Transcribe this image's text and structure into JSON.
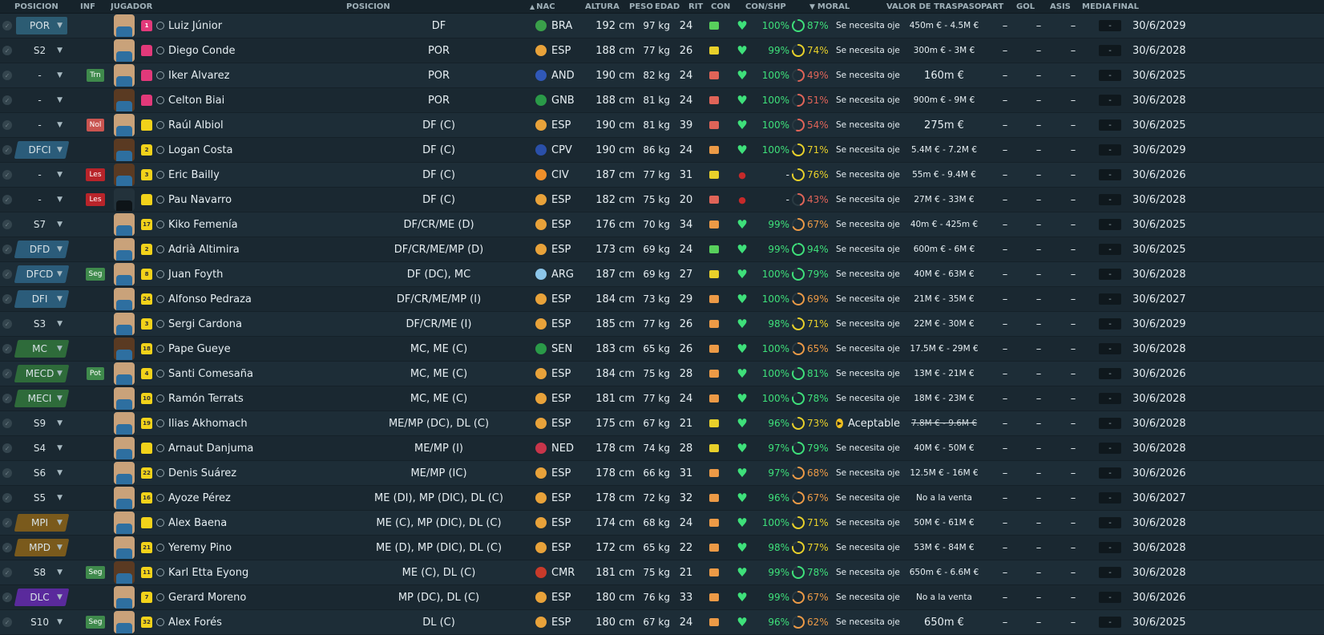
{
  "headers": {
    "pos": "POSICIÓN",
    "inf": "INF",
    "player": "JUGADOR",
    "position": "POSICIÓN",
    "nat": "NAC",
    "height": "ALTURA",
    "weight": "PESO",
    "age": "EDAD",
    "rit": "RIT",
    "con": "CON",
    "conshp": "CON/SHP",
    "moral": "MORAL",
    "value": "VALOR DE TRASPASO",
    "part": "PART",
    "gol": "GOL",
    "asis": "ASIS",
    "media": "MEDIA",
    "final": "FINAL",
    "sort_arrow": "▲",
    "moral_arrow": "▼"
  },
  "rows": [
    {
      "pos": "POR",
      "pos_style": "gk",
      "inf": "",
      "inf_style": "",
      "face": "",
      "shirt": "pink",
      "shirt_no": "1",
      "name": "Luiz Júnior",
      "position": "DF",
      "nat_text": "BRA",
      "flag": "#3aa04a",
      "height": "192 cm",
      "weight": "97 kg",
      "age": "24",
      "rit": "g",
      "con": "heart",
      "con_pct": "100%",
      "shp": "87%",
      "shp_c": "g",
      "shp_frac": 0.87,
      "moral": "Se necesita ojeo",
      "moral_ok": false,
      "value": "450m € - 4.5M €",
      "value_big": false,
      "value_strike": false,
      "part": "–",
      "gol": "–",
      "asis": "–",
      "media": "-",
      "final": "30/6/2029"
    },
    {
      "pos": "S2",
      "pos_style": "plain",
      "inf": "",
      "inf_style": "",
      "face": "",
      "shirt": "pink",
      "shirt_no": "",
      "name": "Diego Conde",
      "position": "POR",
      "nat_text": "ESP",
      "flag": "#e8a23a",
      "height": "188 cm",
      "weight": "77 kg",
      "age": "26",
      "rit": "y",
      "con": "heart",
      "con_pct": "99%",
      "shp": "74%",
      "shp_c": "y",
      "shp_frac": 0.74,
      "moral": "Se necesita ojeo",
      "moral_ok": false,
      "value": "300m € - 3M €",
      "value_big": false,
      "value_strike": false,
      "part": "–",
      "gol": "–",
      "asis": "–",
      "media": "-",
      "final": "30/6/2028"
    },
    {
      "pos": "-",
      "pos_style": "plain",
      "inf": "Trn",
      "inf_style": "trn",
      "face": "",
      "shirt": "pink",
      "shirt_no": "",
      "name": "Iker Álvarez",
      "position": "POR",
      "nat_text": "AND",
      "flag": "#3058b8",
      "height": "190 cm",
      "weight": "82 kg",
      "age": "24",
      "rit": "r",
      "con": "heart",
      "con_pct": "100%",
      "shp": "49%",
      "shp_c": "r",
      "shp_frac": 0.49,
      "moral": "Se necesita ojeo",
      "moral_ok": false,
      "value": "160m €",
      "value_big": true,
      "value_strike": false,
      "part": "–",
      "gol": "–",
      "asis": "–",
      "media": "-",
      "final": "30/6/2025"
    },
    {
      "pos": "-",
      "pos_style": "plain",
      "inf": "",
      "inf_style": "",
      "face": "dark",
      "shirt": "pink",
      "shirt_no": "",
      "name": "Celton Biai",
      "position": "POR",
      "nat_text": "GNB",
      "flag": "#2a9a48",
      "height": "188 cm",
      "weight": "81 kg",
      "age": "24",
      "rit": "r",
      "con": "heart",
      "con_pct": "100%",
      "shp": "51%",
      "shp_c": "r",
      "shp_frac": 0.51,
      "moral": "Se necesita ojeo",
      "moral_ok": false,
      "value": "900m € - 9M €",
      "value_big": false,
      "value_strike": false,
      "part": "–",
      "gol": "–",
      "asis": "–",
      "media": "-",
      "final": "30/6/2028"
    },
    {
      "pos": "-",
      "pos_style": "plain",
      "inf": "Nol",
      "inf_style": "nol",
      "face": "",
      "shirt": "yellow",
      "shirt_no": "",
      "name": "Raúl Albiol",
      "position": "DF (C)",
      "nat_text": "ESP",
      "flag": "#e8a23a",
      "height": "190 cm",
      "weight": "81 kg",
      "age": "39",
      "rit": "r",
      "con": "heart",
      "con_pct": "100%",
      "shp": "54%",
      "shp_c": "r",
      "shp_frac": 0.54,
      "moral": "Se necesita ojeo",
      "moral_ok": false,
      "value": "275m €",
      "value_big": true,
      "value_strike": false,
      "part": "–",
      "gol": "–",
      "asis": "–",
      "media": "-",
      "final": "30/6/2025"
    },
    {
      "pos": "DFCI",
      "pos_style": "def",
      "inf": "",
      "inf_style": "",
      "face": "dark",
      "shirt": "yellow",
      "shirt_no": "2",
      "name": "Logan Costa",
      "position": "DF (C)",
      "nat_text": "CPV",
      "flag": "#2a4fa8",
      "height": "190 cm",
      "weight": "86 kg",
      "age": "24",
      "rit": "o",
      "con": "heart",
      "con_pct": "100%",
      "shp": "71%",
      "shp_c": "y",
      "shp_frac": 0.71,
      "moral": "Se necesita ojeo",
      "moral_ok": false,
      "value": "5.4M € - 7.2M €",
      "value_big": false,
      "value_strike": false,
      "part": "–",
      "gol": "–",
      "asis": "–",
      "media": "-",
      "final": "30/6/2029"
    },
    {
      "pos": "-",
      "pos_style": "plain",
      "inf": "Les",
      "inf_style": "les",
      "face": "dark",
      "shirt": "yellow",
      "shirt_no": "3",
      "name": "Éric Bailly",
      "position": "DF (C)",
      "nat_text": "CIV",
      "flag": "#f0902a",
      "height": "187 cm",
      "weight": "77 kg",
      "age": "31",
      "rit": "y",
      "con": "inj",
      "con_pct": "-",
      "shp": "76%",
      "shp_c": "y",
      "shp_frac": 0.76,
      "moral": "Se necesita ojeo",
      "moral_ok": false,
      "value": "55m € - 9.4M €",
      "value_big": false,
      "value_strike": false,
      "part": "–",
      "gol": "–",
      "asis": "–",
      "media": "-",
      "final": "30/6/2026"
    },
    {
      "pos": "-",
      "pos_style": "plain",
      "inf": "Les",
      "inf_style": "les",
      "face": "blank",
      "shirt": "yellow",
      "shirt_no": "",
      "name": "Pau Navarro",
      "position": "DF (C)",
      "nat_text": "ESP",
      "flag": "#e8a23a",
      "height": "182 cm",
      "weight": "75 kg",
      "age": "20",
      "rit": "r",
      "con": "inj",
      "con_pct": "-",
      "shp": "43%",
      "shp_c": "r",
      "shp_frac": 0.43,
      "moral": "Se necesita ojeo",
      "moral_ok": false,
      "value": "27M € - 33M €",
      "value_big": false,
      "value_strike": false,
      "part": "–",
      "gol": "–",
      "asis": "–",
      "media": "-",
      "final": "30/6/2028"
    },
    {
      "pos": "S7",
      "pos_style": "plain",
      "inf": "",
      "inf_style": "",
      "face": "",
      "shirt": "yellow",
      "shirt_no": "17",
      "name": "Kiko Femenía",
      "position": "DF/CR/ME (D)",
      "nat_text": "ESP",
      "flag": "#e8a23a",
      "height": "176 cm",
      "weight": "70 kg",
      "age": "34",
      "rit": "o",
      "con": "heart",
      "con_pct": "99%",
      "shp": "67%",
      "shp_c": "o",
      "shp_frac": 0.67,
      "moral": "Se necesita ojeo",
      "moral_ok": false,
      "value": "40m € - 425m €",
      "value_big": false,
      "value_strike": false,
      "part": "–",
      "gol": "–",
      "asis": "–",
      "media": "-",
      "final": "30/6/2025"
    },
    {
      "pos": "DFD",
      "pos_style": "def",
      "inf": "",
      "inf_style": "",
      "face": "",
      "shirt": "yellow",
      "shirt_no": "2",
      "name": "Adrià Altimira",
      "position": "DF/CR/ME/MP (D)",
      "nat_text": "ESP",
      "flag": "#e8a23a",
      "height": "173 cm",
      "weight": "69 kg",
      "age": "24",
      "rit": "g",
      "con": "heart",
      "con_pct": "99%",
      "shp": "94%",
      "shp_c": "g",
      "shp_frac": 0.94,
      "moral": "Se necesita ojeo",
      "moral_ok": false,
      "value": "600m € - 6M €",
      "value_big": false,
      "value_strike": false,
      "part": "–",
      "gol": "–",
      "asis": "–",
      "media": "-",
      "final": "30/6/2025"
    },
    {
      "pos": "DFCD",
      "pos_style": "def",
      "inf": "Seg",
      "inf_style": "seg",
      "face": "",
      "shirt": "yellow",
      "shirt_no": "8",
      "name": "Juan Foyth",
      "position": "DF (DC), MC",
      "nat_text": "ARG",
      "flag": "#8cc6ea",
      "height": "187 cm",
      "weight": "69 kg",
      "age": "27",
      "rit": "y",
      "con": "heart",
      "con_pct": "100%",
      "shp": "79%",
      "shp_c": "g",
      "shp_frac": 0.79,
      "moral": "Se necesita ojeo",
      "moral_ok": false,
      "value": "40M € - 63M €",
      "value_big": false,
      "value_strike": false,
      "part": "–",
      "gol": "–",
      "asis": "–",
      "media": "-",
      "final": "30/6/2028"
    },
    {
      "pos": "DFI",
      "pos_style": "def",
      "inf": "",
      "inf_style": "",
      "face": "",
      "shirt": "yellow",
      "shirt_no": "24",
      "name": "Alfonso Pedraza",
      "position": "DF/CR/ME/MP (I)",
      "nat_text": "ESP",
      "flag": "#e8a23a",
      "height": "184 cm",
      "weight": "73 kg",
      "age": "29",
      "rit": "o",
      "con": "heart",
      "con_pct": "100%",
      "shp": "69%",
      "shp_c": "o",
      "shp_frac": 0.69,
      "moral": "Se necesita ojeo",
      "moral_ok": false,
      "value": "21M € - 35M €",
      "value_big": false,
      "value_strike": false,
      "part": "–",
      "gol": "–",
      "asis": "–",
      "media": "-",
      "final": "30/6/2027"
    },
    {
      "pos": "S3",
      "pos_style": "plain",
      "inf": "",
      "inf_style": "",
      "face": "",
      "shirt": "yellow",
      "shirt_no": "3",
      "name": "Sergi Cardona",
      "position": "DF/CR/ME (I)",
      "nat_text": "ESP",
      "flag": "#e8a23a",
      "height": "185 cm",
      "weight": "77 kg",
      "age": "26",
      "rit": "o",
      "con": "heart",
      "con_pct": "98%",
      "shp": "71%",
      "shp_c": "y",
      "shp_frac": 0.71,
      "moral": "Se necesita ojeo",
      "moral_ok": false,
      "value": "22M € - 30M €",
      "value_big": false,
      "value_strike": false,
      "part": "–",
      "gol": "–",
      "asis": "–",
      "media": "-",
      "final": "30/6/2029"
    },
    {
      "pos": "MC",
      "pos_style": "mid",
      "inf": "",
      "inf_style": "",
      "face": "dark",
      "shirt": "yellow",
      "shirt_no": "18",
      "name": "Pape Gueye",
      "position": "MC, ME (C)",
      "nat_text": "SEN",
      "flag": "#2a9a48",
      "height": "183 cm",
      "weight": "65 kg",
      "age": "26",
      "rit": "o",
      "con": "heart",
      "con_pct": "100%",
      "shp": "65%",
      "shp_c": "o",
      "shp_frac": 0.65,
      "moral": "Se necesita ojeo",
      "moral_ok": false,
      "value": "17.5M € - 29M €",
      "value_big": false,
      "value_strike": false,
      "part": "–",
      "gol": "–",
      "asis": "–",
      "media": "-",
      "final": "30/6/2028"
    },
    {
      "pos": "MECD",
      "pos_style": "mid",
      "inf": "Pot",
      "inf_style": "pot",
      "face": "",
      "shirt": "yellow",
      "shirt_no": "4",
      "name": "Santi Comesaña",
      "position": "MC, ME (C)",
      "nat_text": "ESP",
      "flag": "#e8a23a",
      "height": "184 cm",
      "weight": "75 kg",
      "age": "28",
      "rit": "o",
      "con": "heart",
      "con_pct": "100%",
      "shp": "81%",
      "shp_c": "g",
      "shp_frac": 0.81,
      "moral": "Se necesita ojeo",
      "moral_ok": false,
      "value": "13M € - 21M €",
      "value_big": false,
      "value_strike": false,
      "part": "–",
      "gol": "–",
      "asis": "–",
      "media": "-",
      "final": "30/6/2026"
    },
    {
      "pos": "MECI",
      "pos_style": "mid",
      "inf": "",
      "inf_style": "",
      "face": "",
      "shirt": "yellow",
      "shirt_no": "10",
      "name": "Ramón Terrats",
      "position": "MC, ME (C)",
      "nat_text": "ESP",
      "flag": "#e8a23a",
      "height": "181 cm",
      "weight": "77 kg",
      "age": "24",
      "rit": "o",
      "con": "heart",
      "con_pct": "100%",
      "shp": "78%",
      "shp_c": "g",
      "shp_frac": 0.78,
      "moral": "Se necesita ojeo",
      "moral_ok": false,
      "value": "18M € - 23M €",
      "value_big": false,
      "value_strike": false,
      "part": "–",
      "gol": "–",
      "asis": "–",
      "media": "-",
      "final": "30/6/2028"
    },
    {
      "pos": "S9",
      "pos_style": "plain",
      "inf": "",
      "inf_style": "",
      "face": "",
      "shirt": "yellow",
      "shirt_no": "19",
      "name": "Ilias Akhomach",
      "position": "ME/MP (DC), DL (C)",
      "nat_text": "ESP",
      "flag": "#e8a23a",
      "height": "175 cm",
      "weight": "67 kg",
      "age": "21",
      "rit": "y",
      "con": "heart",
      "con_pct": "96%",
      "shp": "73%",
      "shp_c": "y",
      "shp_frac": 0.73,
      "moral": "Aceptable",
      "moral_ok": true,
      "value": "7.8M € - 9.6M €",
      "value_big": false,
      "value_strike": true,
      "part": "–",
      "gol": "–",
      "asis": "–",
      "media": "-",
      "final": "30/6/2028"
    },
    {
      "pos": "S4",
      "pos_style": "plain",
      "inf": "",
      "inf_style": "",
      "face": "",
      "shirt": "yellow",
      "shirt_no": "",
      "name": "Arnaut Danjuma",
      "position": "ME/MP (I)",
      "nat_text": "NED",
      "flag": "#c8354a",
      "height": "178 cm",
      "weight": "74 kg",
      "age": "28",
      "rit": "y",
      "con": "heart",
      "con_pct": "97%",
      "shp": "79%",
      "shp_c": "g",
      "shp_frac": 0.79,
      "moral": "Se necesita ojeo",
      "moral_ok": false,
      "value": "40M € - 50M €",
      "value_big": false,
      "value_strike": false,
      "part": "–",
      "gol": "–",
      "asis": "–",
      "media": "-",
      "final": "30/6/2028"
    },
    {
      "pos": "S6",
      "pos_style": "plain",
      "inf": "",
      "inf_style": "",
      "face": "",
      "shirt": "yellow",
      "shirt_no": "22",
      "name": "Denis Suárez",
      "position": "ME/MP (IC)",
      "nat_text": "ESP",
      "flag": "#e8a23a",
      "height": "178 cm",
      "weight": "66 kg",
      "age": "31",
      "rit": "o",
      "con": "heart",
      "con_pct": "97%",
      "shp": "68%",
      "shp_c": "o",
      "shp_frac": 0.68,
      "moral": "Se necesita ojeo",
      "moral_ok": false,
      "value": "12.5M € - 16M €",
      "value_big": false,
      "value_strike": false,
      "part": "–",
      "gol": "–",
      "asis": "–",
      "media": "-",
      "final": "30/6/2026"
    },
    {
      "pos": "S5",
      "pos_style": "plain",
      "inf": "",
      "inf_style": "",
      "face": "",
      "shirt": "yellow",
      "shirt_no": "16",
      "name": "Ayoze Pérez",
      "position": "ME (DI), MP (DIC), DL (C)",
      "nat_text": "ESP",
      "flag": "#e8a23a",
      "height": "178 cm",
      "weight": "72 kg",
      "age": "32",
      "rit": "o",
      "con": "heart",
      "con_pct": "96%",
      "shp": "67%",
      "shp_c": "o",
      "shp_frac": 0.67,
      "moral": "Se necesita ojeo",
      "moral_ok": false,
      "value": "No a la venta",
      "value_big": false,
      "value_strike": false,
      "part": "–",
      "gol": "–",
      "asis": "–",
      "media": "-",
      "final": "30/6/2027"
    },
    {
      "pos": "MPI",
      "pos_style": "wing",
      "inf": "",
      "inf_style": "",
      "face": "",
      "shirt": "yellow",
      "shirt_no": "",
      "name": "Álex Baena",
      "position": "ME (C), MP (DIC), DL (C)",
      "nat_text": "ESP",
      "flag": "#e8a23a",
      "height": "174 cm",
      "weight": "68 kg",
      "age": "24",
      "rit": "o",
      "con": "heart",
      "con_pct": "100%",
      "shp": "71%",
      "shp_c": "y",
      "shp_frac": 0.71,
      "moral": "Se necesita ojeo",
      "moral_ok": false,
      "value": "50M € - 61M €",
      "value_big": false,
      "value_strike": false,
      "part": "–",
      "gol": "–",
      "asis": "–",
      "media": "-",
      "final": "30/6/2028"
    },
    {
      "pos": "MPD",
      "pos_style": "wing",
      "inf": "",
      "inf_style": "",
      "face": "",
      "shirt": "yellow",
      "shirt_no": "21",
      "name": "Yeremy Pino",
      "position": "ME (D), MP (DIC), DL (C)",
      "nat_text": "ESP",
      "flag": "#e8a23a",
      "height": "172 cm",
      "weight": "65 kg",
      "age": "22",
      "rit": "o",
      "con": "heart",
      "con_pct": "98%",
      "shp": "77%",
      "shp_c": "y",
      "shp_frac": 0.77,
      "moral": "Se necesita ojeo",
      "moral_ok": false,
      "value": "53M € - 84M €",
      "value_big": false,
      "value_strike": false,
      "part": "–",
      "gol": "–",
      "asis": "–",
      "media": "-",
      "final": "30/6/2028"
    },
    {
      "pos": "S8",
      "pos_style": "plain",
      "inf": "Seg",
      "inf_style": "seg",
      "face": "dark",
      "shirt": "yellow",
      "shirt_no": "11",
      "name": "Karl Etta Eyong",
      "position": "ME (C), DL (C)",
      "nat_text": "CMR",
      "flag": "#c83a2a",
      "height": "181 cm",
      "weight": "75 kg",
      "age": "21",
      "rit": "o",
      "con": "heart",
      "con_pct": "99%",
      "shp": "78%",
      "shp_c": "g",
      "shp_frac": 0.78,
      "moral": "Se necesita ojeo",
      "moral_ok": false,
      "value": "650m € - 6.6M €",
      "value_big": false,
      "value_strike": false,
      "part": "–",
      "gol": "–",
      "asis": "–",
      "media": "-",
      "final": "30/6/2028"
    },
    {
      "pos": "DLC",
      "pos_style": "att",
      "inf": "",
      "inf_style": "",
      "face": "",
      "shirt": "yellow",
      "shirt_no": "7",
      "name": "Gerard Moreno",
      "position": "MP (DC), DL (C)",
      "nat_text": "ESP",
      "flag": "#e8a23a",
      "height": "180 cm",
      "weight": "76 kg",
      "age": "33",
      "rit": "o",
      "con": "heart",
      "con_pct": "99%",
      "shp": "67%",
      "shp_c": "o",
      "shp_frac": 0.67,
      "moral": "Se necesita ojeo",
      "moral_ok": false,
      "value": "No a la venta",
      "value_big": false,
      "value_strike": false,
      "part": "–",
      "gol": "–",
      "asis": "–",
      "media": "-",
      "final": "30/6/2026"
    },
    {
      "pos": "S10",
      "pos_style": "plain",
      "inf": "Seg",
      "inf_style": "seg",
      "face": "",
      "shirt": "yellow",
      "shirt_no": "32",
      "name": "Álex Forés",
      "position": "DL (C)",
      "nat_text": "ESP",
      "flag": "#e8a23a",
      "height": "180 cm",
      "weight": "67 kg",
      "age": "24",
      "rit": "o",
      "con": "heart",
      "con_pct": "96%",
      "shp": "62%",
      "shp_c": "o",
      "shp_frac": 0.62,
      "moral": "Se necesita ojeo",
      "moral_ok": false,
      "value": "650m €",
      "value_big": true,
      "value_strike": false,
      "part": "–",
      "gol": "–",
      "asis": "–",
      "media": "-",
      "final": "30/6/2025"
    }
  ]
}
